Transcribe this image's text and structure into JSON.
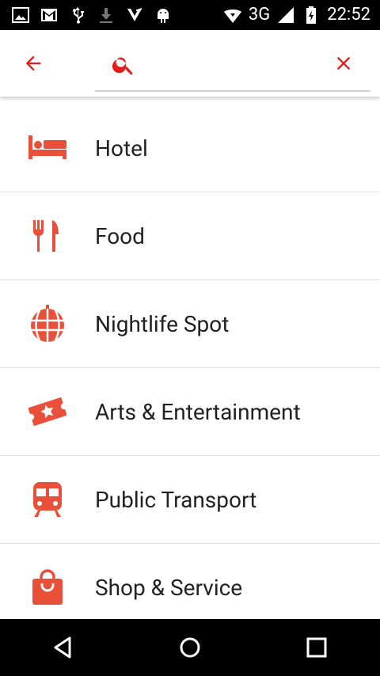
{
  "status_bar": {
    "time": "22:52",
    "network": "3G",
    "icons": [
      "image-icon",
      "gmail-icon",
      "usb-icon",
      "download-icon",
      "task-icon",
      "android-icon",
      "wifi-icon",
      "signal-icon",
      "battery-charging-icon"
    ]
  },
  "app_bar": {
    "back_icon": "arrow-back-icon",
    "search_icon": "search-icon",
    "search_value": "",
    "search_placeholder": "",
    "clear_icon": "close-icon",
    "accent_color": "#e51c1c"
  },
  "categories": [
    {
      "label": "Hotel",
      "icon": "bed-icon"
    },
    {
      "label": "Food",
      "icon": "fork-knife-icon"
    },
    {
      "label": "Nightlife Spot",
      "icon": "disco-ball-icon"
    },
    {
      "label": "Arts & Entertainment",
      "icon": "ticket-icon"
    },
    {
      "label": "Public Transport",
      "icon": "train-icon"
    },
    {
      "label": "Shop & Service",
      "icon": "shopping-bag-icon"
    }
  ],
  "icon_color": "#e8503a",
  "nav_bar": {
    "back": "nav-back-icon",
    "home": "nav-home-icon",
    "recents": "nav-recents-icon"
  }
}
